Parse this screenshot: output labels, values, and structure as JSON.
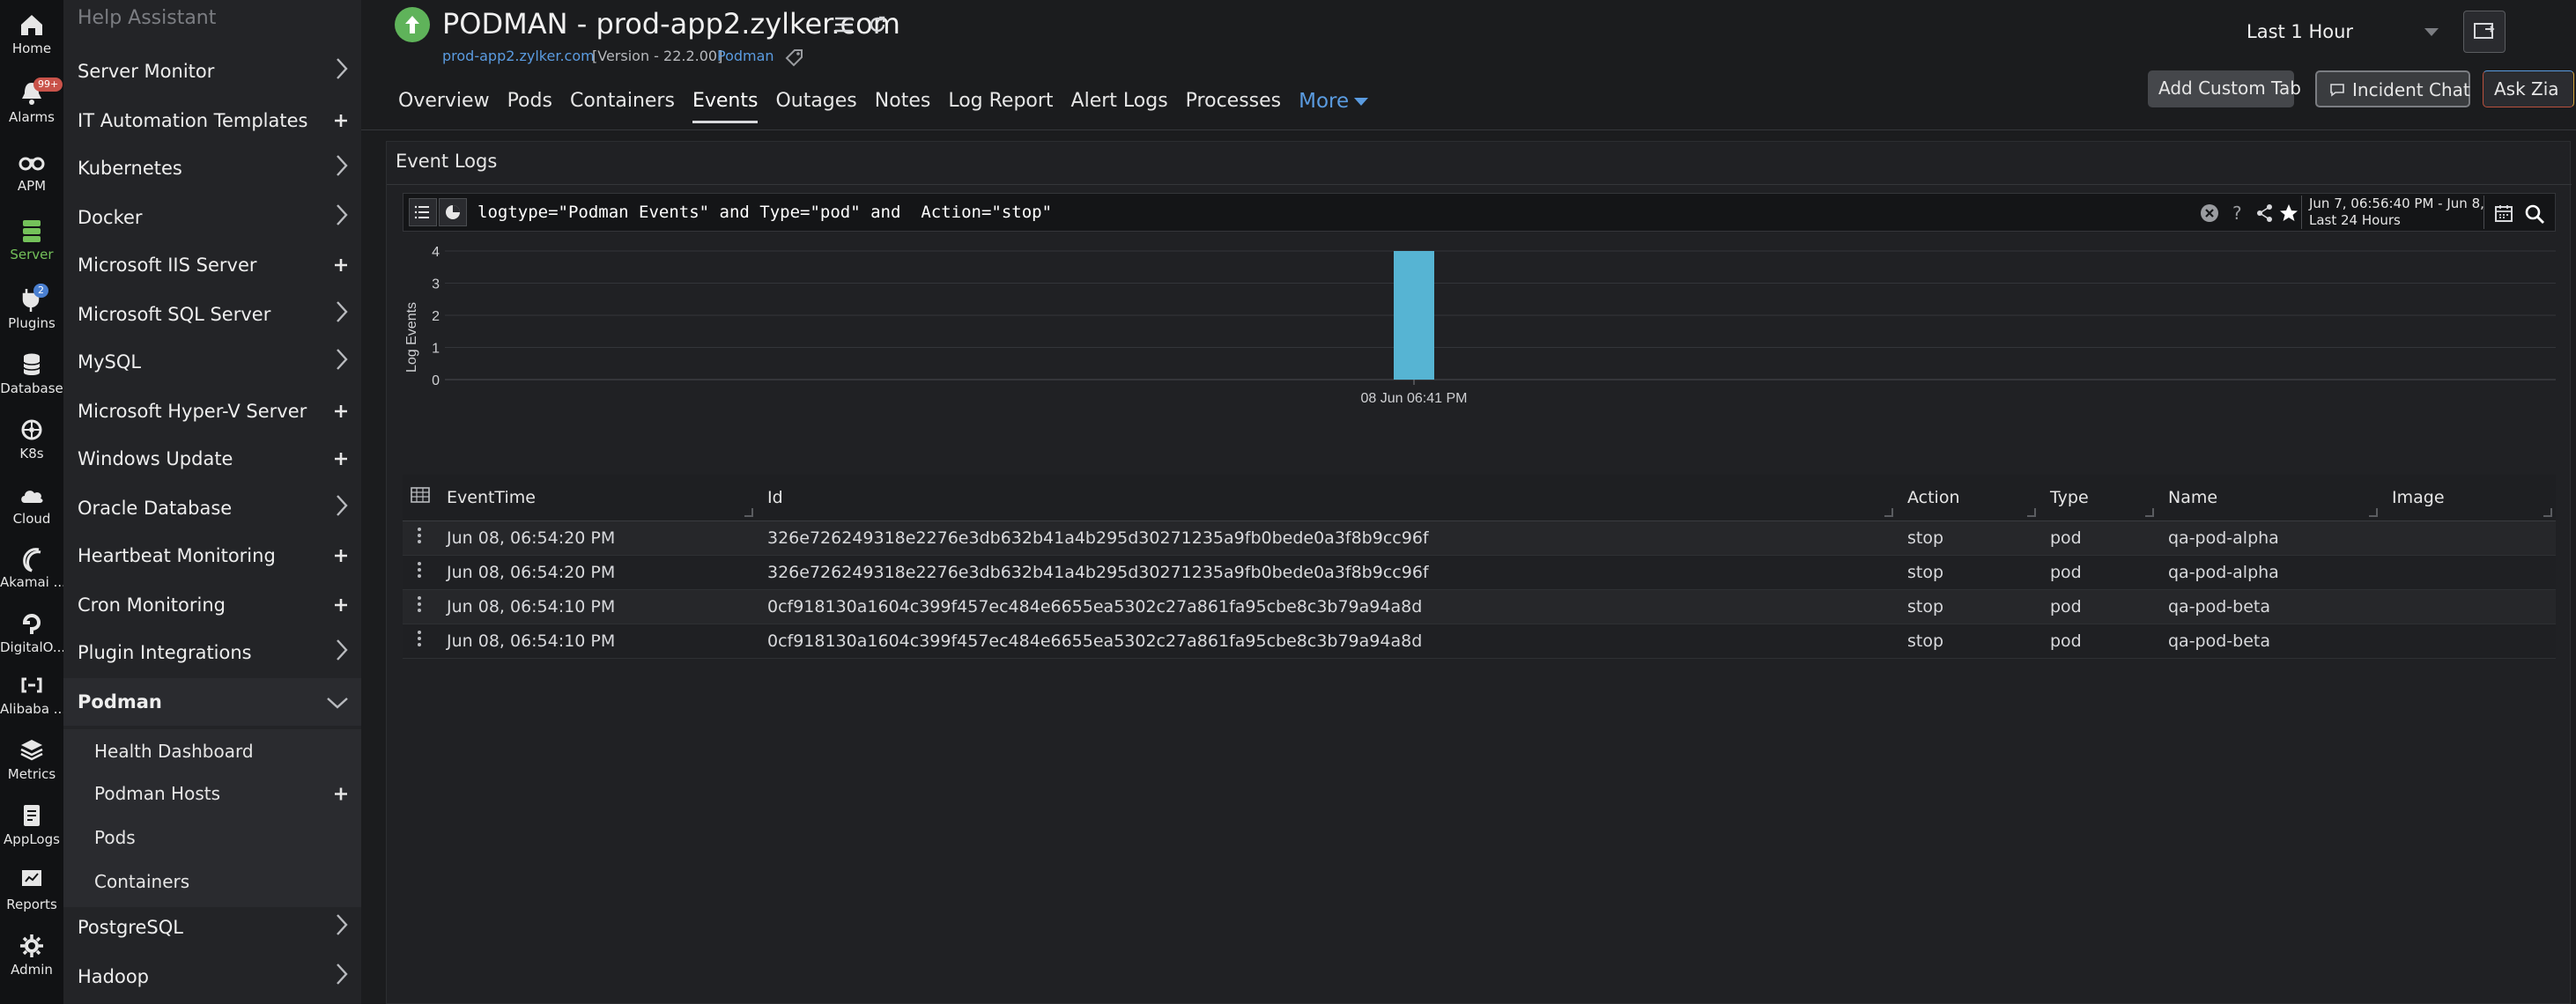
{
  "rail": {
    "items": [
      {
        "label": "Home",
        "icon": "home-icon"
      },
      {
        "label": "Alarms",
        "icon": "bell-icon",
        "badge": "99+"
      },
      {
        "label": "APM",
        "icon": "binoculars-icon"
      },
      {
        "label": "Server",
        "icon": "server-icon",
        "active": true
      },
      {
        "label": "Plugins",
        "icon": "plug-icon",
        "badge": "2"
      },
      {
        "label": "Database",
        "icon": "database-icon"
      },
      {
        "label": "K8s",
        "icon": "kubernetes-icon"
      },
      {
        "label": "Cloud",
        "icon": "cloud-icon"
      },
      {
        "label": "Akamai ...",
        "icon": "akamai-icon"
      },
      {
        "label": "DigitalO...",
        "icon": "digitalocean-icon"
      },
      {
        "label": "Alibaba ...",
        "icon": "alibaba-icon"
      },
      {
        "label": "Metrics",
        "icon": "layers-icon"
      },
      {
        "label": "AppLogs",
        "icon": "applogs-icon"
      },
      {
        "label": "Reports",
        "icon": "reports-icon"
      },
      {
        "label": "Admin",
        "icon": "gear-icon"
      }
    ]
  },
  "nav": {
    "header": "Help Assistant",
    "items": [
      {
        "label": "Server Monitor",
        "ctl": "chevron"
      },
      {
        "label": "IT Automation Templates",
        "ctl": "plus"
      },
      {
        "label": "Kubernetes",
        "ctl": "chevron"
      },
      {
        "label": "Docker",
        "ctl": "chevron"
      },
      {
        "label": "Microsoft IIS Server",
        "ctl": "plus"
      },
      {
        "label": "Microsoft SQL Server",
        "ctl": "chevron"
      },
      {
        "label": "MySQL",
        "ctl": "chevron"
      },
      {
        "label": "Microsoft Hyper-V Server",
        "ctl": "plus"
      },
      {
        "label": "Windows Update",
        "ctl": "plus"
      },
      {
        "label": "Oracle Database",
        "ctl": "chevron"
      },
      {
        "label": "Heartbeat Monitoring",
        "ctl": "plus"
      },
      {
        "label": "Cron Monitoring",
        "ctl": "plus"
      },
      {
        "label": "Plugin Integrations",
        "ctl": "chevron"
      },
      {
        "label": "Podman",
        "ctl": "chevron-down"
      }
    ],
    "sub_items": [
      {
        "label": "Health Dashboard",
        "ctl": ""
      },
      {
        "label": "Podman Hosts",
        "ctl": "plus"
      },
      {
        "label": "Pods",
        "ctl": ""
      },
      {
        "label": "Containers",
        "ctl": ""
      }
    ],
    "after_items": [
      {
        "label": "PostgreSQL",
        "ctl": "chevron"
      },
      {
        "label": "Hadoop",
        "ctl": "chevron"
      }
    ]
  },
  "header": {
    "title": "PODMAN - prod-app2.zylker.com",
    "host_link": "prod-app2.zylker.com",
    "version": "[Version - 22.2.00]",
    "monitor_type": "Podman",
    "time_range": "Last 1 Hour",
    "buttons": {
      "custom_tab": "Add Custom Tab",
      "incident_chat": "Incident Chat",
      "ask_zia": "Ask Zia"
    },
    "tabs": [
      {
        "label": "Overview"
      },
      {
        "label": "Pods"
      },
      {
        "label": "Containers"
      },
      {
        "label": "Events",
        "active": true
      },
      {
        "label": "Outages"
      },
      {
        "label": "Notes"
      },
      {
        "label": "Log Report"
      },
      {
        "label": "Alert Logs"
      },
      {
        "label": "Processes"
      }
    ],
    "more_label": "More"
  },
  "panel": {
    "title": "Event Logs",
    "query": "logtype=\"Podman Events\" and Type=\"pod\" and  Action=\"stop\"",
    "range_line1": "Jun 7, 06:56:40 PM - Jun 8, ...",
    "range_line2": "Last 24 Hours"
  },
  "chart_data": {
    "type": "bar",
    "categories": [
      "08 Jun 06:41 PM"
    ],
    "values": [
      4
    ],
    "ylabel": "Log Events",
    "ylim": [
      0,
      4
    ],
    "yticks": [
      0,
      1,
      2,
      3,
      4
    ],
    "bar_color": "#56b4d3",
    "grid": true
  },
  "table": {
    "columns": [
      "EventTime",
      "Id",
      "Action",
      "Type",
      "Name",
      "Image"
    ],
    "rows": [
      [
        "Jun 08, 06:54:20 PM",
        "326e726249318e2276e3db632b41a4b295d30271235a9fb0bede0a3f8b9cc96f",
        "stop",
        "pod",
        "qa-pod-alpha",
        ""
      ],
      [
        "Jun 08, 06:54:20 PM",
        "326e726249318e2276e3db632b41a4b295d30271235a9fb0bede0a3f8b9cc96f",
        "stop",
        "pod",
        "qa-pod-alpha",
        ""
      ],
      [
        "Jun 08, 06:54:10 PM",
        "0cf918130a1604c399f457ec484e6655ea5302c27a861fa95cbe8c3b79a94a8d",
        "stop",
        "pod",
        "qa-pod-beta",
        ""
      ],
      [
        "Jun 08, 06:54:10 PM",
        "0cf918130a1604c399f457ec484e6655ea5302c27a861fa95cbe8c3b79a94a8d",
        "stop",
        "pod",
        "qa-pod-beta",
        ""
      ]
    ]
  }
}
